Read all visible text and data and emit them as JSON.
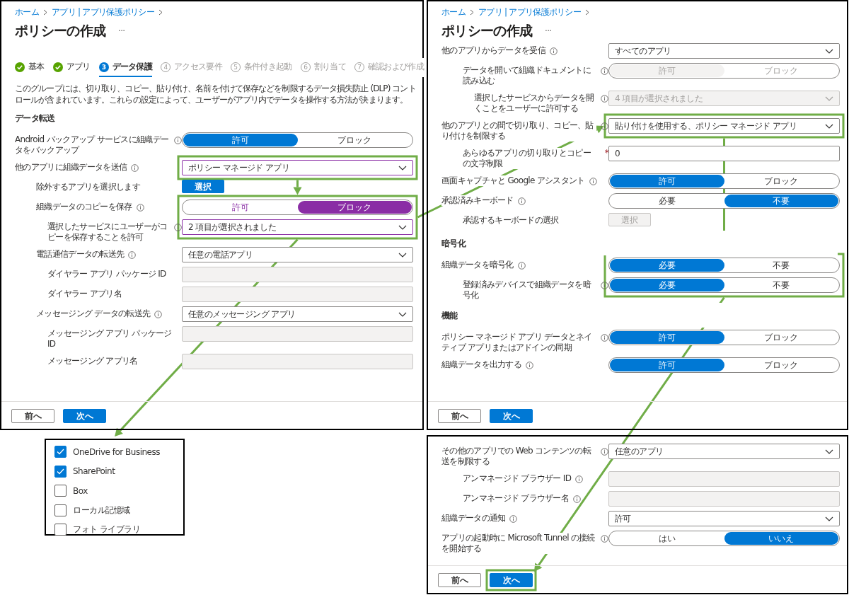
{
  "panels": [
    {
      "kind": "wizard-page",
      "breadcrumb": [
        "ホーム",
        "アプリ | アプリ保護ポリシー"
      ],
      "title": "ポリシーの作成",
      "more": "···",
      "steps": [
        {
          "label": "基本",
          "completed": true,
          "selected": false
        },
        {
          "label": "アプリ",
          "completed": true,
          "selected": false
        },
        {
          "number": "3",
          "label": "データ保護",
          "completed": false,
          "selected": true
        },
        {
          "number": "4",
          "label": "アクセス要件",
          "completed": false,
          "selected": false
        },
        {
          "number": "5",
          "label": "条件付き起動",
          "completed": false,
          "selected": false
        },
        {
          "number": "6",
          "label": "割り当て",
          "completed": false,
          "selected": false
        },
        {
          "number": "7",
          "label": "確認および作成",
          "completed": false,
          "selected": false
        }
      ],
      "description": "このグループには、切り取り、コピー、貼り付け、名前を付けて保存などを制限するデータ損失防止 (DLP) コントロールが含まれています。これらの設定によって、ユーザーがアプリ内でデータを操作する方法が決まります。",
      "sections": [
        {
          "heading": "データ転送",
          "settings": [
            {
              "kind": "toggle",
              "label": "Android バックアップ サービスに組織データをバックアップ",
              "info": true,
              "disabled": false,
              "modified": false,
              "options": [
                {
                  "label": "許可",
                  "selected": true
                },
                {
                  "label": "ブロック",
                  "selected": false
                }
              ]
            },
            {
              "kind": "dropdown",
              "label": "他のアプリに組織データを送信",
              "info": true,
              "disabled": false,
              "modified": true,
              "value": "ポリシー マネージド アプリ",
              "children": [
                {
                  "kind": "button",
                  "label": "除外するアプリを選択します",
                  "button_label": "選択",
                  "disabled": false
                },
                {
                  "kind": "toggle",
                  "label": "組織データのコピーを保存",
                  "info": true,
                  "disabled": false,
                  "modified": true,
                  "options": [
                    {
                      "label": "許可",
                      "selected": false
                    },
                    {
                      "label": "ブロック",
                      "selected": true
                    }
                  ],
                  "children": [
                    {
                      "kind": "dropdown",
                      "label": "選択したサービスにユーザーがコピーを保存することを許可",
                      "info": true,
                      "disabled": false,
                      "modified": true,
                      "value": "2 項目が選択されました"
                    }
                  ]
                },
                {
                  "kind": "dropdown",
                  "label": "電話通信データの転送先",
                  "info": true,
                  "disabled": false,
                  "modified": false,
                  "value": "任意の電話アプリ",
                  "children": [
                    {
                      "kind": "text-field",
                      "label": "ダイヤラー アプリ パッケージ ID",
                      "info": false,
                      "disabled": true
                    },
                    {
                      "kind": "text-field",
                      "label": "ダイヤラー アプリ名",
                      "info": false,
                      "disabled": true
                    }
                  ]
                },
                {
                  "kind": "dropdown",
                  "label": "メッセージング データの転送先",
                  "info": true,
                  "disabled": false,
                  "modified": false,
                  "value": "任意のメッセージング アプリ",
                  "children": [
                    {
                      "kind": "text-field",
                      "label": "メッセージング アプリ パッケージ ID",
                      "info": false,
                      "disabled": true
                    },
                    {
                      "kind": "text-field",
                      "label": "メッセージング アプリ名",
                      "info": false,
                      "disabled": true
                    }
                  ]
                }
              ]
            }
          ]
        }
      ],
      "footer_buttons": [
        {
          "label": "前へ",
          "primary": false
        },
        {
          "label": "次へ",
          "primary": true
        }
      ]
    },
    {
      "kind": "checkbox-list",
      "items": [
        {
          "label": "OneDrive for Business",
          "checked": true
        },
        {
          "label": "SharePoint",
          "checked": true
        },
        {
          "label": "Box",
          "checked": false
        },
        {
          "label": "ローカル記憶域",
          "checked": false
        },
        {
          "label": "フォト ライブラリ",
          "checked": false
        }
      ]
    },
    {
      "kind": "wizard-page",
      "breadcrumb": [
        "ホーム",
        "アプリ | アプリ保護ポリシー"
      ],
      "title": "ポリシーの作成",
      "more": "···",
      "sections": [
        {
          "settings": [
            {
              "kind": "dropdown",
              "label": "他のアプリからデータを受信",
              "info": true,
              "disabled": false,
              "modified": false,
              "value": "すべてのアプリ",
              "children": [
                {
                  "kind": "toggle",
                  "label": "データを開いて組織ドキュメントに読み込む",
                  "info": true,
                  "disabled": true,
                  "modified": false,
                  "options": [
                    {
                      "label": "許可",
                      "selected": true
                    },
                    {
                      "label": "ブロック",
                      "selected": false
                    }
                  ],
                  "children": [
                    {
                      "kind": "dropdown",
                      "label": "選択したサービスからデータを開くことをユーザーに許可する",
                      "info": true,
                      "disabled": true,
                      "modified": false,
                      "value": "4 項目が選択されました"
                    }
                  ]
                }
              ]
            },
            {
              "kind": "dropdown",
              "label": "他のアプリとの間で切り取り、コピー、貼り付けを制限する",
              "info": true,
              "disabled": false,
              "modified": false,
              "value": "貼り付けを使用する、ポリシー マネージド アプリ",
              "children": [
                {
                  "kind": "text-field",
                  "label": "あらゆるアプリの切り取りとコピーの文字制限",
                  "info": false,
                  "disabled": false,
                  "required_mark": "*",
                  "value": "0"
                }
              ]
            },
            {
              "kind": "toggle",
              "label": "画面キャプチャと Google アシスタント",
              "info": true,
              "disabled": false,
              "modified": false,
              "options": [
                {
                  "label": "許可",
                  "selected": true
                },
                {
                  "label": "ブロック",
                  "selected": false
                }
              ]
            },
            {
              "kind": "toggle",
              "label": "承認済みキーボード",
              "info": true,
              "disabled": false,
              "modified": false,
              "options": [
                {
                  "label": "必要",
                  "selected": false
                },
                {
                  "label": "不要",
                  "selected": true
                }
              ],
              "children": [
                {
                  "kind": "button",
                  "label": "承認するキーボードの選択",
                  "button_label": "選択",
                  "disabled": true
                }
              ]
            }
          ]
        },
        {
          "heading": "暗号化",
          "settings": [
            {
              "kind": "toggle",
              "label": "組織データを暗号化",
              "info": true,
              "disabled": false,
              "modified": false,
              "options": [
                {
                  "label": "必要",
                  "selected": true
                },
                {
                  "label": "不要",
                  "selected": false
                }
              ],
              "children": [
                {
                  "kind": "toggle",
                  "label": "登録済みデバイスで組織データを暗号化",
                  "info": true,
                  "disabled": false,
                  "modified": false,
                  "options": [
                    {
                      "label": "必要",
                      "selected": true
                    },
                    {
                      "label": "不要",
                      "selected": false
                    }
                  ]
                }
              ]
            }
          ]
        },
        {
          "heading": "機能",
          "settings": [
            {
              "kind": "toggle",
              "label": "ポリシー マネージド アプリ データとネイティブ アプリまたはアドインの同期",
              "info": true,
              "disabled": false,
              "modified": false,
              "options": [
                {
                  "label": "許可",
                  "selected": true
                },
                {
                  "label": "ブロック",
                  "selected": false
                }
              ]
            },
            {
              "kind": "toggle",
              "label": "組織データを出力する",
              "info": true,
              "disabled": false,
              "modified": false,
              "options": [
                {
                  "label": "許可",
                  "selected": true
                },
                {
                  "label": "ブロック",
                  "selected": false
                }
              ]
            }
          ]
        }
      ],
      "footer_buttons": [
        {
          "label": "前へ",
          "primary": false
        },
        {
          "label": "次へ",
          "primary": true
        }
      ]
    },
    {
      "kind": "wizard-page",
      "sections": [
        {
          "settings": [
            {
              "kind": "dropdown",
              "label": "その他のアプリでの Web コンテンツの転送を制限する",
              "info": true,
              "disabled": false,
              "modified": false,
              "value": "任意のアプリ",
              "children": [
                {
                  "kind": "text-field",
                  "label": "アンマネージド ブラウザー ID",
                  "info": true,
                  "disabled": true
                },
                {
                  "kind": "text-field",
                  "label": "アンマネージド ブラウザー名",
                  "info": true,
                  "disabled": true
                }
              ]
            },
            {
              "kind": "dropdown",
              "label": "組織データの通知",
              "info": true,
              "disabled": false,
              "modified": false,
              "value": "許可"
            },
            {
              "kind": "toggle",
              "label": "アプリの起動時に Microsoft Tunnel の接続を開始する",
              "info": true,
              "disabled": false,
              "modified": false,
              "options": [
                {
                  "label": "はい",
                  "selected": false
                },
                {
                  "label": "いいえ",
                  "selected": true
                }
              ]
            }
          ]
        }
      ],
      "footer_buttons": [
        {
          "label": "前へ",
          "primary": false
        },
        {
          "label": "次へ",
          "primary": true
        }
      ]
    }
  ]
}
